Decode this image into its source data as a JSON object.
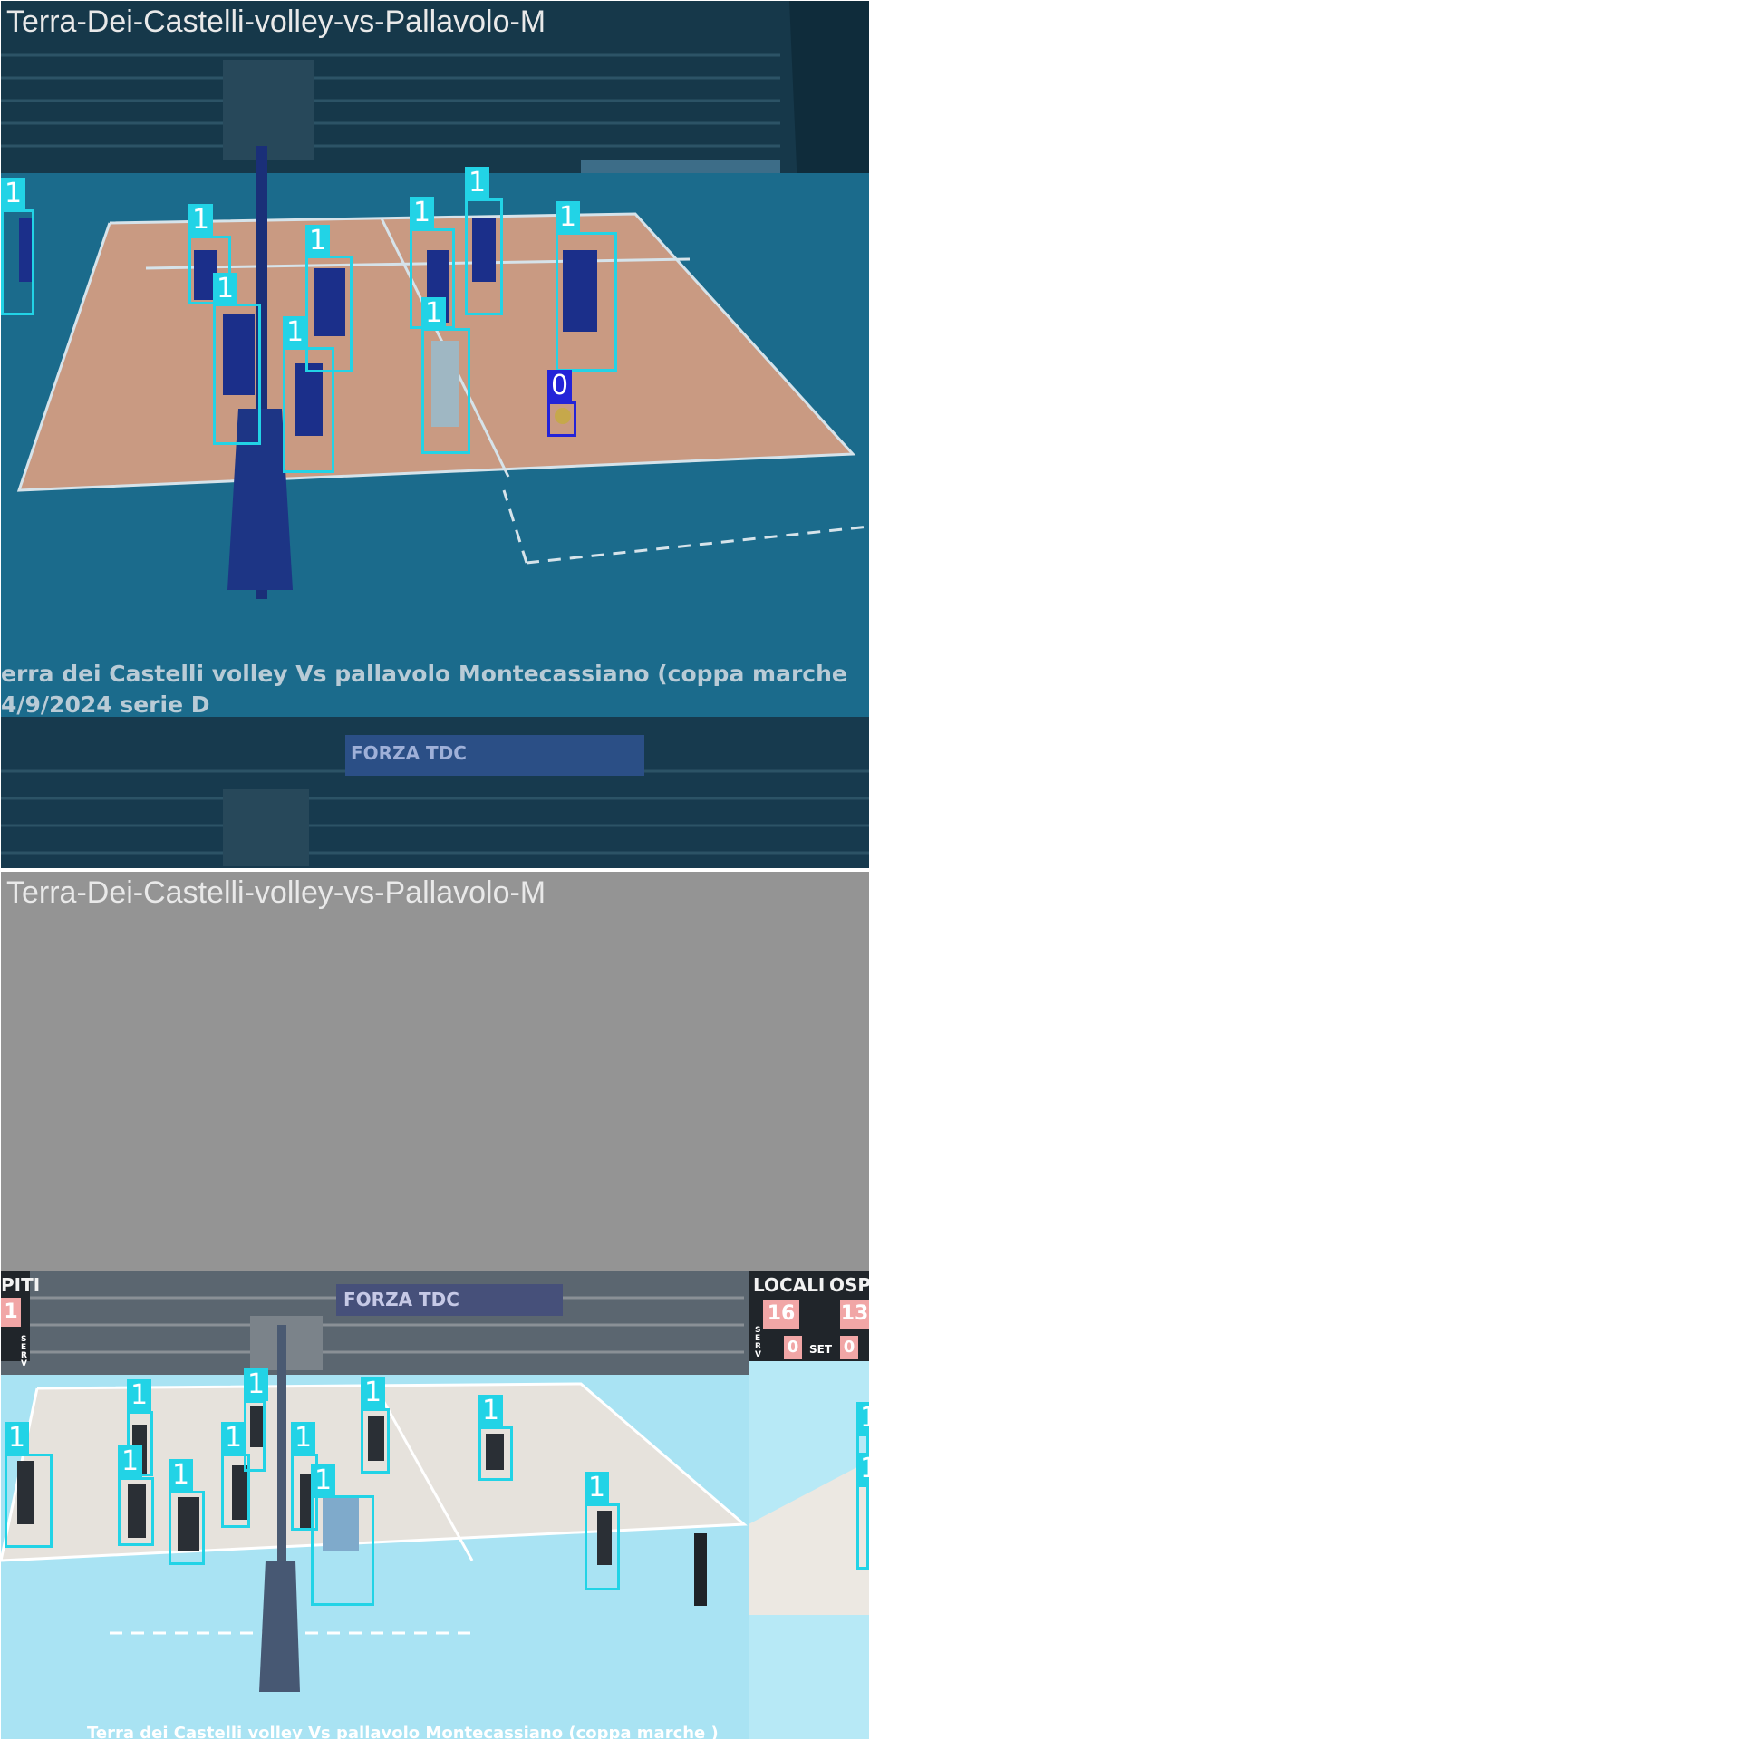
{
  "tiles": [
    {
      "title": "Terra-Dei-Castelli-volley-vs-Pallavolo-M",
      "overlay_line1": "erra dei Castelli  volley  Vs  pallavolo Montecassiano   (coppa marche",
      "overlay_line2": "4/9/2024    serie D",
      "banner": "FORZA TDC",
      "detections": [
        {
          "label": "1"
        },
        {
          "label": "1"
        },
        {
          "label": "1"
        },
        {
          "label": "1"
        },
        {
          "label": "1"
        },
        {
          "label": "1"
        },
        {
          "label": "1"
        },
        {
          "label": "1"
        },
        {
          "label": "1"
        },
        {
          "label": "1"
        },
        {
          "label": "0"
        }
      ]
    },
    {
      "title": "Terra-Dei-Castelli-volley-vs-Pallavolo-M",
      "banner": "FORZA TDC",
      "scoreboard_left": {
        "team": "PITI",
        "points": "1",
        "serv": "S E R V"
      },
      "scoreboard_right": {
        "home": "LOCALI",
        "away": "OSPI",
        "home_points": "16",
        "away_points": "13",
        "home_sets": "0",
        "away_sets": "0",
        "set_label": "SET",
        "serv": "S E R V"
      },
      "overlay_line1": "Terra dei Castelli volley  Vs  pallavolo Montecassiano   (coppa marche  )",
      "detections": [
        {
          "label": "1"
        },
        {
          "label": "1"
        },
        {
          "label": "1"
        },
        {
          "label": "1"
        },
        {
          "label": "1"
        },
        {
          "label": "1"
        },
        {
          "label": "1"
        },
        {
          "label": "1"
        },
        {
          "label": "1"
        },
        {
          "label": "1"
        },
        {
          "label": "1"
        },
        {
          "label": "1"
        },
        {
          "label": "1"
        },
        {
          "label": "1"
        }
      ]
    }
  ],
  "colors": {
    "person_box": "#22d3e6",
    "ball_box": "#2323d8",
    "title_text": "#e9e9e9"
  }
}
